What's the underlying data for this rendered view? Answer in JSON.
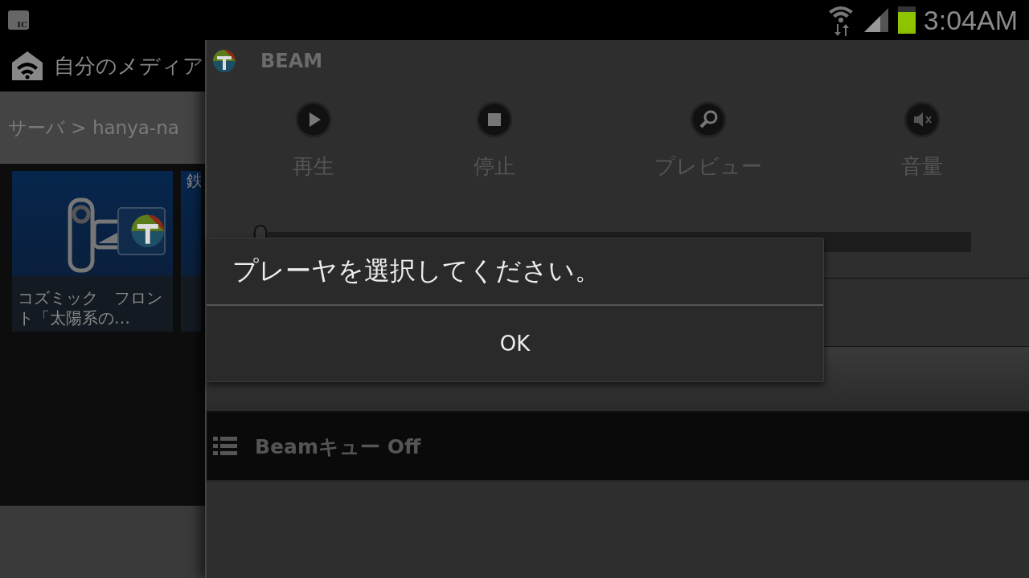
{
  "status_bar": {
    "notification_label": "IC",
    "time": "3:04AM"
  },
  "app": {
    "title": "自分のメディア",
    "breadcrumb": "サーバ > hanya-na",
    "tiles": [
      {
        "caption": "コズミック　フロント「太陽系の…",
        "kind": "video"
      },
      {
        "caption": "鉄",
        "kind": "partial"
      }
    ]
  },
  "beam_panel": {
    "title": "BEAM",
    "controls": [
      {
        "kind": "play",
        "label": "再生"
      },
      {
        "kind": "stop",
        "label": "停止"
      },
      {
        "kind": "preview",
        "label": "プレビュー"
      },
      {
        "kind": "mute",
        "label": "音量"
      }
    ],
    "seek": {
      "level": 0.01
    },
    "queue": {
      "label": "Beamキュー Off"
    }
  },
  "dialog": {
    "message": "プレーヤを選択してください。",
    "buttons": [
      "OK"
    ]
  }
}
